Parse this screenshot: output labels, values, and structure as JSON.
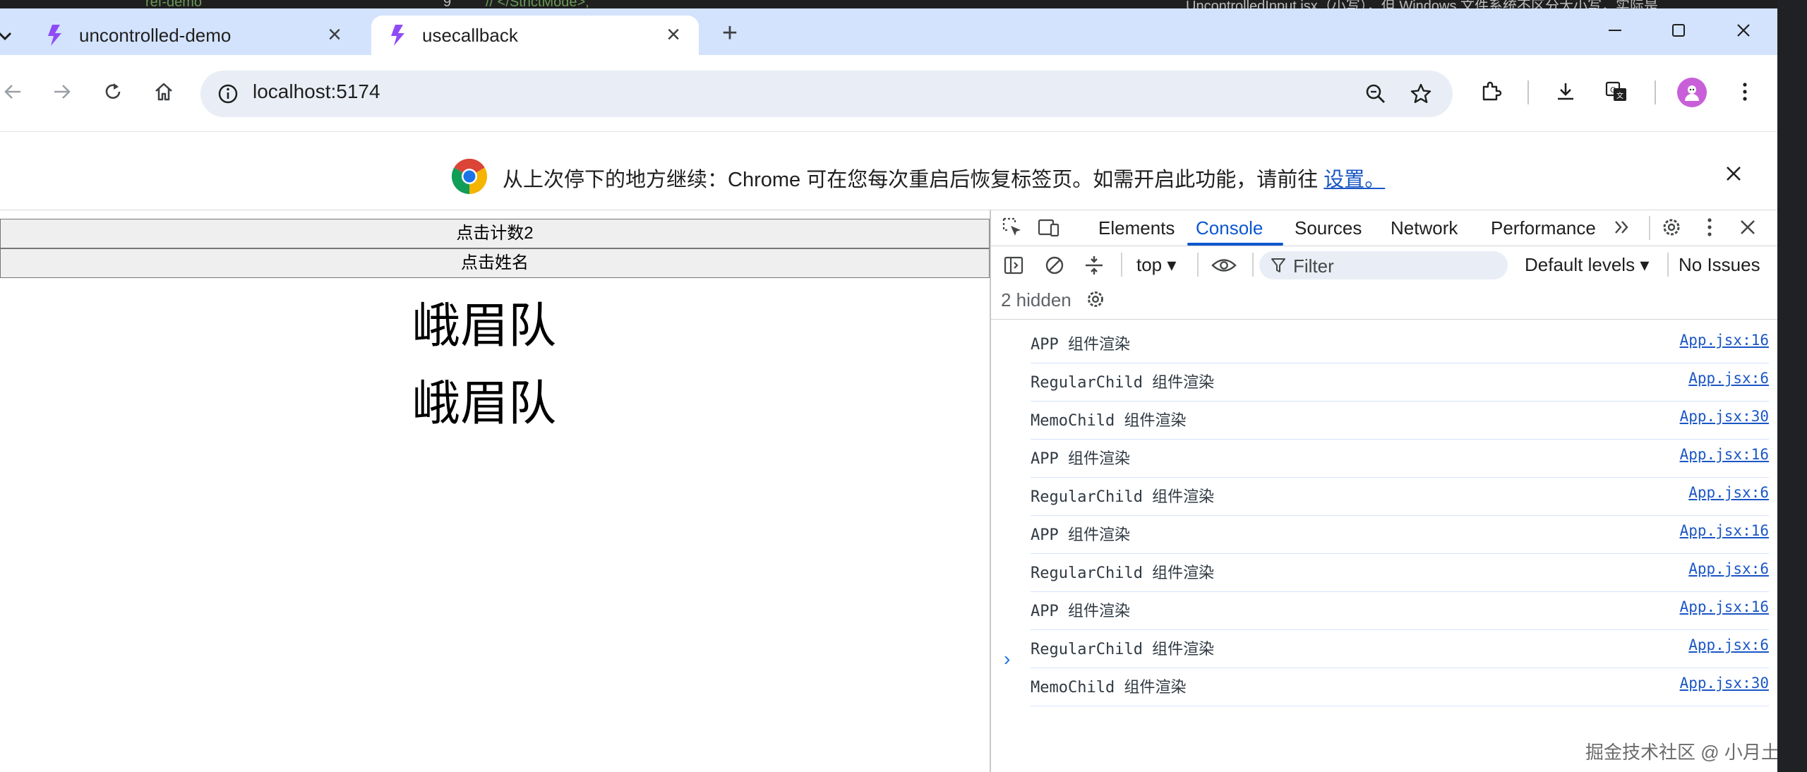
{
  "browser": {
    "tabs": [
      {
        "title": "uncontrolled-demo",
        "active": false
      },
      {
        "title": "usecallback",
        "active": true
      }
    ],
    "address": "localhost:5174",
    "infobar": {
      "message": "从上次停下的地方继续：Chrome 可在您每次重启后恢复标签页。如需开启此功能，请前往",
      "link": "设置。"
    }
  },
  "page": {
    "buttons": [
      "点击计数2",
      "点击姓名"
    ],
    "names": [
      "峨眉队",
      "峨眉队"
    ]
  },
  "devtools": {
    "tabs": [
      "Elements",
      "Console",
      "Sources",
      "Network",
      "Performance"
    ],
    "active_tab": "Console",
    "context": "top",
    "filter_placeholder": "Filter",
    "levels": "Default levels",
    "issues": "No Issues",
    "hidden": "2 hidden",
    "logs": [
      {
        "msg": "APP 组件渲染",
        "src": "App.jsx:16"
      },
      {
        "msg": "RegularChild 组件渲染",
        "src": "App.jsx:6"
      },
      {
        "msg": "MemoChild 组件渲染",
        "src": "App.jsx:30"
      },
      {
        "msg": "APP 组件渲染",
        "src": "App.jsx:16"
      },
      {
        "msg": "RegularChild 组件渲染",
        "src": "App.jsx:6"
      },
      {
        "msg": "APP 组件渲染",
        "src": "App.jsx:16"
      },
      {
        "msg": "RegularChild 组件渲染",
        "src": "App.jsx:6"
      },
      {
        "msg": "APP 组件渲染",
        "src": "App.jsx:16"
      },
      {
        "msg": "RegularChild 组件渲染",
        "src": "App.jsx:6"
      },
      {
        "msg": "MemoChild 组件渲染",
        "src": "App.jsx:30"
      }
    ]
  },
  "background": {
    "left_snippet": "ref-demo",
    "code_snippet": "//  </StrictMode>,",
    "right_snippet": "UncontrolledInput.jsx（小写），但 Windows 文件系统不区分大小写，实际是"
  },
  "watermark": "掘金技术社区 @ 小月土星",
  "colors": {
    "accent": "#0b57d0",
    "tabstrip": "#d3e3fd",
    "link": "#1a56c5"
  }
}
